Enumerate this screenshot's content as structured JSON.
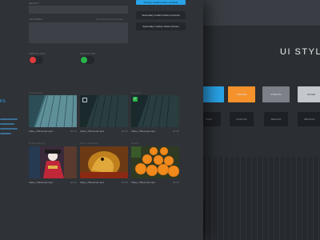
{
  "background": {
    "title": "UI STYLE",
    "swatches": [
      {
        "label": "",
        "color": "#2aa3e8"
      },
      {
        "label": "",
        "color": "#2aa3e8"
      },
      {
        "label": "ORANGE",
        "color": "#f5922b"
      },
      {
        "label": "STEALTH",
        "color": "#7d8088"
      },
      {
        "label": "SILVER",
        "color": "#c4c8cd"
      }
    ],
    "dark_swatches": [
      "DUSK",
      "SHADOW",
      "BEDOUR",
      "BEDRUM"
    ]
  },
  "form": {
    "select_label": "SELECT",
    "textarea_label": "TEXTAREA",
    "char_counter": "140 characters remaining",
    "primary_button": "Primary medium button (default)",
    "secondary_button_normal": "Secondary medium button (normal)",
    "secondary_button_hover": "Secondary medium button (hover)"
  },
  "switches": {
    "off_label": "SWITCH OFF",
    "on_label": "SWITCH ON"
  },
  "section_fragment": {
    "title": "KS"
  },
  "media": [
    {
      "caption": "Not selected",
      "name": "Video_75Insomia.mp4",
      "duration": "00:38",
      "state": "none",
      "art": "building"
    },
    {
      "caption": "",
      "name": "Video_75Insomia.mp4",
      "duration": "00:38",
      "state": "unchecked",
      "art": "dark-building"
    },
    {
      "caption": "Selected",
      "name": "Video_75Insomia.mp4",
      "duration": "00:38",
      "state": "checked",
      "art": "dark-building"
    },
    {
      "caption": "Default (Hover)",
      "name": "Video_75Insomia.mp4",
      "duration": "00:38",
      "state": "none",
      "art": "geisha"
    },
    {
      "caption": "Hover (Selected)",
      "name": "Video_75Insomia.mp4",
      "duration": "00:38",
      "state": "none",
      "art": "dragon"
    },
    {
      "caption": "Default",
      "name": "Video_75Insomia.mp4",
      "duration": "00:38",
      "state": "none",
      "art": "oranges"
    }
  ],
  "colors": {
    "accent": "#2aa3e8",
    "switch_off": "#e03a3e",
    "switch_on": "#28b44a",
    "check": "#28b44a"
  }
}
